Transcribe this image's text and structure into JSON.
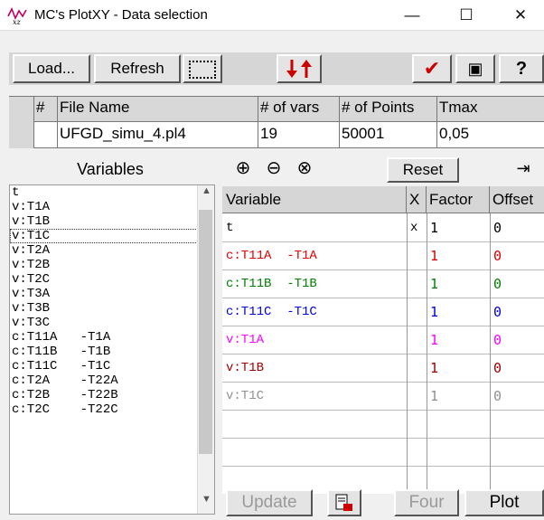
{
  "window": {
    "title": "MC's PlotXY - Data selection",
    "minimize": "—",
    "maximize": "☐",
    "close": "✕"
  },
  "toolbar": {
    "load": "Load...",
    "refresh": "Refresh",
    "check": "✔",
    "copy": "▣",
    "help": "?"
  },
  "file_table": {
    "headers": [
      "#",
      "File Name",
      "# of vars",
      "# of Points",
      "Tmax"
    ],
    "row": {
      "num": "",
      "name": "UFGD_simu_4.pl4",
      "vars": "19",
      "points": "50001",
      "tmax": "0,05"
    }
  },
  "variables": {
    "heading": "Variables",
    "items": [
      "t",
      "v:T1A",
      "v:T1B",
      "v:T1C",
      "v:T2A",
      "v:T2B",
      "v:T2C",
      "v:T3A",
      "v:T3B",
      "v:T3C",
      "c:T11A   -T1A",
      "c:T11B   -T1B",
      "c:T11C   -T1C",
      "c:T2A    -T22A",
      "c:T2B    -T22B",
      "c:T2C    -T22C"
    ],
    "selected_index": 3
  },
  "plot_controls": {
    "plus": "⊕",
    "minus": "⊖",
    "clear": "⊗",
    "reset": "Reset",
    "move_right": "⇥"
  },
  "plot_table": {
    "headers": [
      "Variable",
      "X",
      "Factor",
      "Offset"
    ],
    "rows": [
      {
        "variable": "t",
        "x": "x",
        "factor": "1",
        "offset": "0",
        "color": "#000000"
      },
      {
        "variable": "c:T11A  -T1A",
        "x": "",
        "factor": "1",
        "offset": "0",
        "color": "#e00000"
      },
      {
        "variable": "c:T11B  -T1B",
        "x": "",
        "factor": "1",
        "offset": "0",
        "color": "#008000"
      },
      {
        "variable": "c:T11C  -T1C",
        "x": "",
        "factor": "1",
        "offset": "0",
        "color": "#0000e0"
      },
      {
        "variable": "v:T1A",
        "x": "",
        "factor": "1",
        "offset": "0",
        "color": "#ff00ff"
      },
      {
        "variable": "v:T1B",
        "x": "",
        "factor": "1",
        "offset": "0",
        "color": "#a00000"
      },
      {
        "variable": "v:T1C",
        "x": "",
        "factor": "1",
        "offset": "0",
        "color": "#909090"
      },
      {
        "variable": "",
        "x": "",
        "factor": "",
        "offset": "",
        "color": "#000000"
      },
      {
        "variable": "",
        "x": "",
        "factor": "",
        "offset": "",
        "color": "#000000"
      }
    ]
  },
  "bottom_buttons": {
    "update": "Update",
    "four": "Four",
    "plot": "Plot"
  }
}
